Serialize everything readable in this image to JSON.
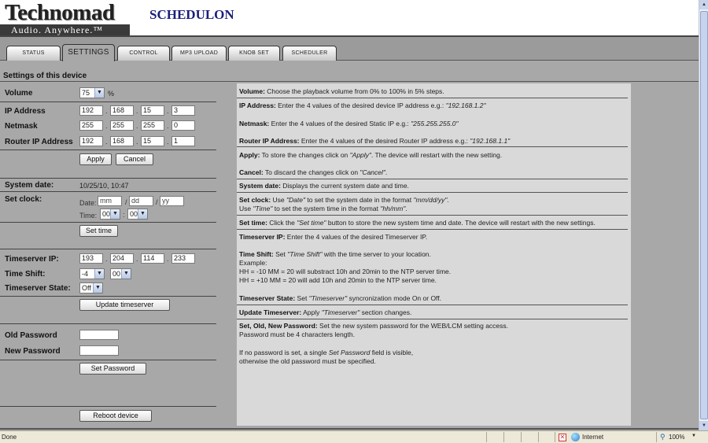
{
  "header": {
    "logo": "Technomad",
    "tagline": "Audio.  Anywhere.™",
    "app_title": "SCHEDULON"
  },
  "tabs": [
    {
      "label": "STATUS"
    },
    {
      "label": "SETTINGS",
      "active": true
    },
    {
      "label": "CONTROL"
    },
    {
      "label": "MP3 UPLOAD"
    },
    {
      "label": "KNOB SET"
    },
    {
      "label": "SCHEDULER"
    }
  ],
  "section_title": "Settings of this device",
  "form": {
    "volume_label": "Volume",
    "volume_value": "75",
    "volume_unit": "%",
    "ip_label": "IP Address",
    "ip": [
      "192",
      "168",
      "15",
      "3"
    ],
    "netmask_label": "Netmask",
    "netmask": [
      "255",
      "255",
      "255",
      "0"
    ],
    "router_label": "Router IP Address",
    "router": [
      "192",
      "168",
      "15",
      "1"
    ],
    "apply_label": "Apply",
    "cancel_label": "Cancel",
    "system_date_label": "System date:",
    "system_date_value": "10/25/10, 10:47",
    "set_clock_label": "Set clock:",
    "date_label": "Date:",
    "date_mm_placeholder": "mm",
    "date_dd_placeholder": "dd",
    "date_yy_placeholder": "yy",
    "date_sep": "/",
    "time_label": "Time:",
    "time_hh": "00",
    "time_mm": "00",
    "time_sep": ":",
    "set_time_label": "Set time",
    "timeserver_ip_label": "Timeserver IP:",
    "timeserver_ip": [
      "193",
      "204",
      "114",
      "233"
    ],
    "time_shift_label": "Time Shift:",
    "time_shift_hours": "-4",
    "time_shift_minutes": "00",
    "timeserver_state_label": "Timeserver State:",
    "timeserver_state": "Off",
    "update_timeserver_label": "Update timeserver",
    "old_password_label": "Old Password",
    "new_password_label": "New Password",
    "set_password_label": "Set Password",
    "reboot_label": "Reboot device",
    "ip_sep": "."
  },
  "help": {
    "volume_title": "Volume:",
    "volume_text": " Choose the playback volume from 0% to 100% in 5% steps.",
    "ip_title": "IP Address:",
    "ip_text": " Enter the 4 values of the desired device IP address e.g.: ",
    "ip_example": "\"192.168.1.2\"",
    "netmask_title": "Netmask:",
    "netmask_text": " Enter the 4 values of the desired Static IP e.g.: ",
    "netmask_example": "\"255.255.255.0\"",
    "router_title": "Router IP Address:",
    "router_text": " Enter the 4 values of the desired Router IP address e.g.: ",
    "router_example": "\"192.168.1.1\"",
    "apply_title": "Apply:",
    "apply_text_1": " To store the changes click on ",
    "apply_em": "\"Apply\"",
    "apply_text_2": ". The device will restart with the new setting.",
    "cancel_title": "Cancel:",
    "cancel_text_1": " To discard the changes click on ",
    "cancel_em": "\"Cancel\"",
    "cancel_text_2": ".",
    "sysdate_title": "System date:",
    "sysdate_text": " Displays the current system date and time.",
    "setclock_title": "Set clock:",
    "setclock_text_1": " Use ",
    "setclock_em_1": "\"Date\"",
    "setclock_text_2": " to set the system date in the format ",
    "setclock_em_2": "\"mm/dd/yy\"",
    "setclock_text_3": ".",
    "setclock_line2_1": "Use ",
    "setclock_em_3": "\"Time\"",
    "setclock_line2_2": " to set the system time in the format ",
    "setclock_em_4": "\"hh/mm\"",
    "setclock_line2_3": ".",
    "settime_title": "Set time:",
    "settime_text_1": " Click the ",
    "settime_em": "\"Set time\"",
    "settime_text_2": " button to store the new system time and date. The device will restart with the new settings.",
    "tsip_title": "Timeserver IP:",
    "tsip_text": " Enter the 4 values of the desired Timeserver IP.",
    "shift_title": "Time Shift:",
    "shift_text_1": " Set ",
    "shift_em": "\"Time Shift\"",
    "shift_text_2": " with the time server to your location.",
    "shift_example_label": "Example:",
    "shift_example_1": "HH = -10 MM = 20 will substract 10h and 20min to the NTP server time.",
    "shift_example_2": "HH = +10 MM = 20 will add 10h and 20min to the NTP server time.",
    "tsstate_title": "Timeserver State:",
    "tsstate_text_1": " Set ",
    "tsstate_em": "\"Timeserver\"",
    "tsstate_text_2": " syncronization mode On or Off.",
    "update_title": "Update Timeserver:",
    "update_text_1": " Apply ",
    "update_em": "\"Timeserver\"",
    "update_text_2": " section changes.",
    "pw_title": "Set, Old, New Password:",
    "pw_text": " Set the new system password for the WEB/LCM setting access.",
    "pw_line2": "Password must be 4 characters length.",
    "pw_line3_1": "If no password is set, a single ",
    "pw_em": "Set Password",
    "pw_line3_2": " field is visible,",
    "pw_line4": "otherwise the old password must be specified."
  },
  "statusbar": {
    "status": "Done",
    "zone": "Internet",
    "zoom": "100%"
  },
  "colors": {
    "page_bg": "#a8a8a8",
    "help_bg": "#d9d9d9",
    "title_blue": "#1a1f7a"
  }
}
